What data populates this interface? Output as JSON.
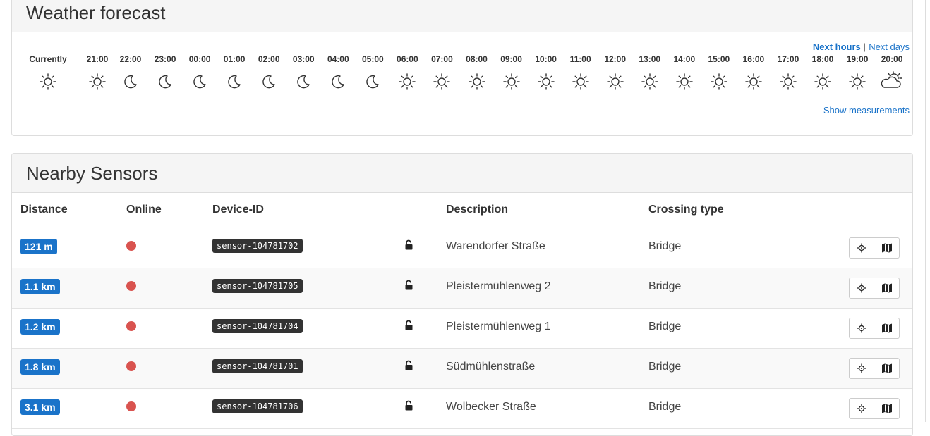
{
  "weather": {
    "title": "Weather forecast",
    "nav": {
      "next_hours": "Next hours",
      "separator": "|",
      "next_days": "Next days"
    },
    "show_measurements": "Show measurements",
    "forecast": [
      {
        "time": "Currently",
        "icon": "sun-icon"
      },
      {
        "time": "21:00",
        "icon": "sun-icon"
      },
      {
        "time": "22:00",
        "icon": "moon-icon"
      },
      {
        "time": "23:00",
        "icon": "moon-icon"
      },
      {
        "time": "00:00",
        "icon": "moon-icon"
      },
      {
        "time": "01:00",
        "icon": "moon-icon"
      },
      {
        "time": "02:00",
        "icon": "moon-icon"
      },
      {
        "time": "03:00",
        "icon": "moon-icon"
      },
      {
        "time": "04:00",
        "icon": "moon-icon"
      },
      {
        "time": "05:00",
        "icon": "moon-icon"
      },
      {
        "time": "06:00",
        "icon": "sun-icon"
      },
      {
        "time": "07:00",
        "icon": "sun-icon"
      },
      {
        "time": "08:00",
        "icon": "sun-icon"
      },
      {
        "time": "09:00",
        "icon": "sun-icon"
      },
      {
        "time": "10:00",
        "icon": "sun-icon"
      },
      {
        "time": "11:00",
        "icon": "sun-icon"
      },
      {
        "time": "12:00",
        "icon": "sun-icon"
      },
      {
        "time": "13:00",
        "icon": "sun-icon"
      },
      {
        "time": "14:00",
        "icon": "sun-icon"
      },
      {
        "time": "15:00",
        "icon": "sun-icon"
      },
      {
        "time": "16:00",
        "icon": "sun-icon"
      },
      {
        "time": "17:00",
        "icon": "sun-icon"
      },
      {
        "time": "18:00",
        "icon": "sun-icon"
      },
      {
        "time": "19:00",
        "icon": "sun-icon"
      },
      {
        "time": "20:00",
        "icon": "partly-cloudy-icon"
      }
    ]
  },
  "sensors": {
    "title": "Nearby Sensors",
    "columns": {
      "distance": "Distance",
      "online": "Online",
      "device_id": "Device-ID",
      "description": "Description",
      "crossing_type": "Crossing type"
    },
    "rows": [
      {
        "distance": "121 m",
        "online": false,
        "device_id": "sensor-104781702",
        "locked": false,
        "description": "Warendorfer Straße",
        "crossing_type": "Bridge"
      },
      {
        "distance": "1.1 km",
        "online": false,
        "device_id": "sensor-104781705",
        "locked": false,
        "description": "Pleistermühlenweg 2",
        "crossing_type": "Bridge"
      },
      {
        "distance": "1.2 km",
        "online": false,
        "device_id": "sensor-104781704",
        "locked": false,
        "description": "Pleistermühlenweg 1",
        "crossing_type": "Bridge"
      },
      {
        "distance": "1.8 km",
        "online": false,
        "device_id": "sensor-104781701",
        "locked": false,
        "description": "Südmühlenstraße",
        "crossing_type": "Bridge"
      },
      {
        "distance": "3.1 km",
        "online": false,
        "device_id": "sensor-104781706",
        "locked": false,
        "description": "Wolbecker Straße",
        "crossing_type": "Bridge"
      }
    ],
    "row_icons": {
      "status": "offline-dot-icon",
      "lock": "unlocked-padlock-icon",
      "locate": "crosshair-icon",
      "map": "map-icon"
    }
  },
  "colors": {
    "accent": "#1a73c9",
    "offline": "#d9534f",
    "device_id_bg": "#333333",
    "panel_heading_bg": "#f5f5f5"
  }
}
